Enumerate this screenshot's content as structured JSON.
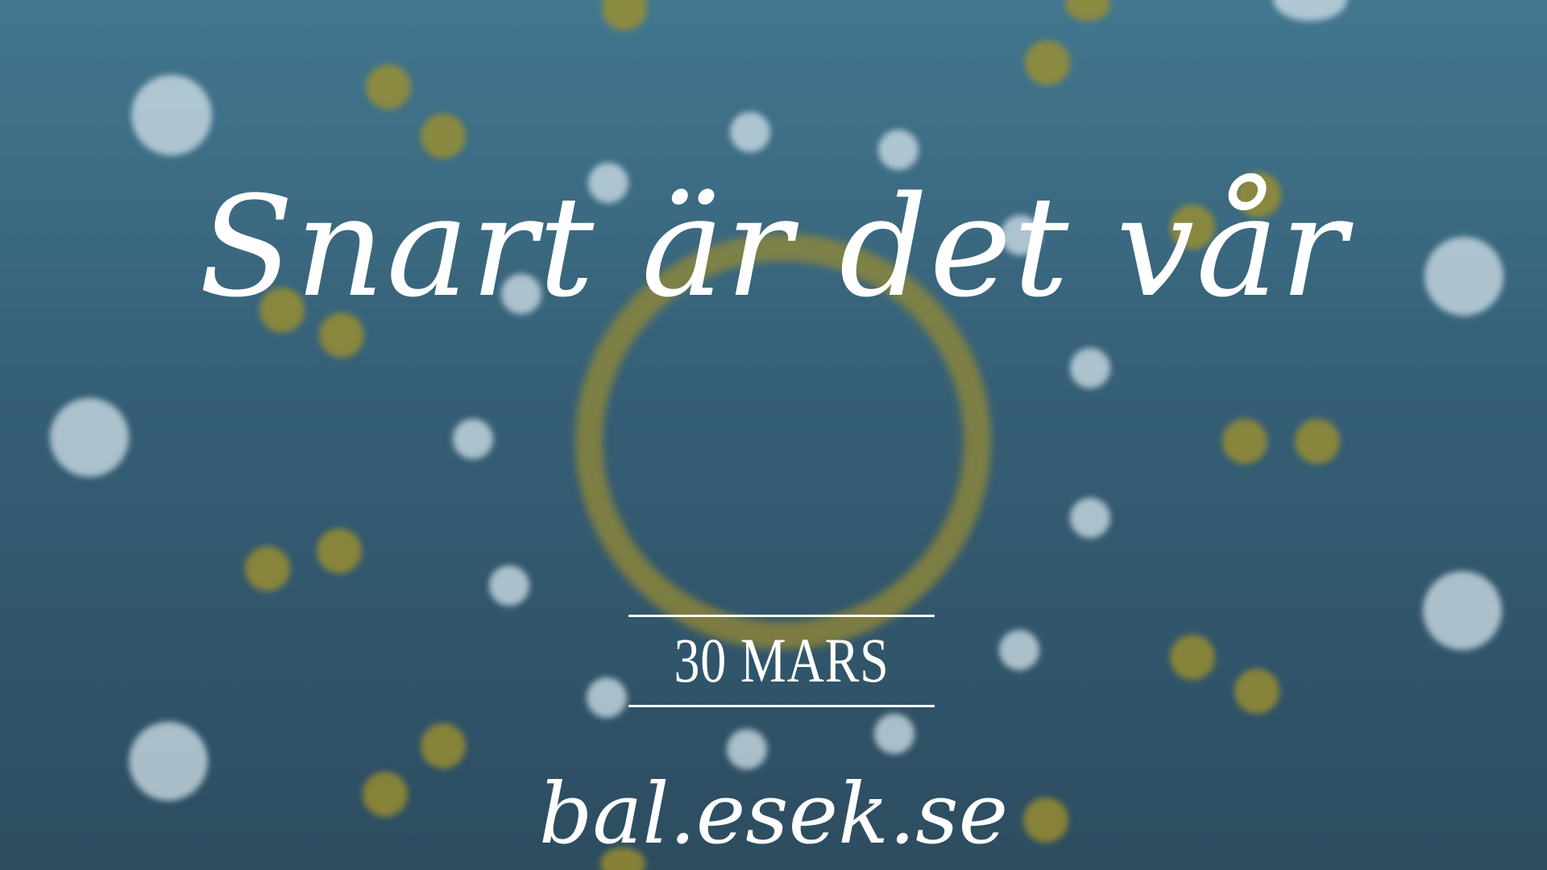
{
  "headline": "Snart är det vår",
  "date": "30 MARS",
  "website": "bal.esek.se",
  "colors": {
    "background_top": "#42778f",
    "background_bottom": "#2d4c60",
    "text": "#ffffff",
    "bokeh_white": "#cddee6",
    "bokeh_gold": "#a0912d"
  }
}
